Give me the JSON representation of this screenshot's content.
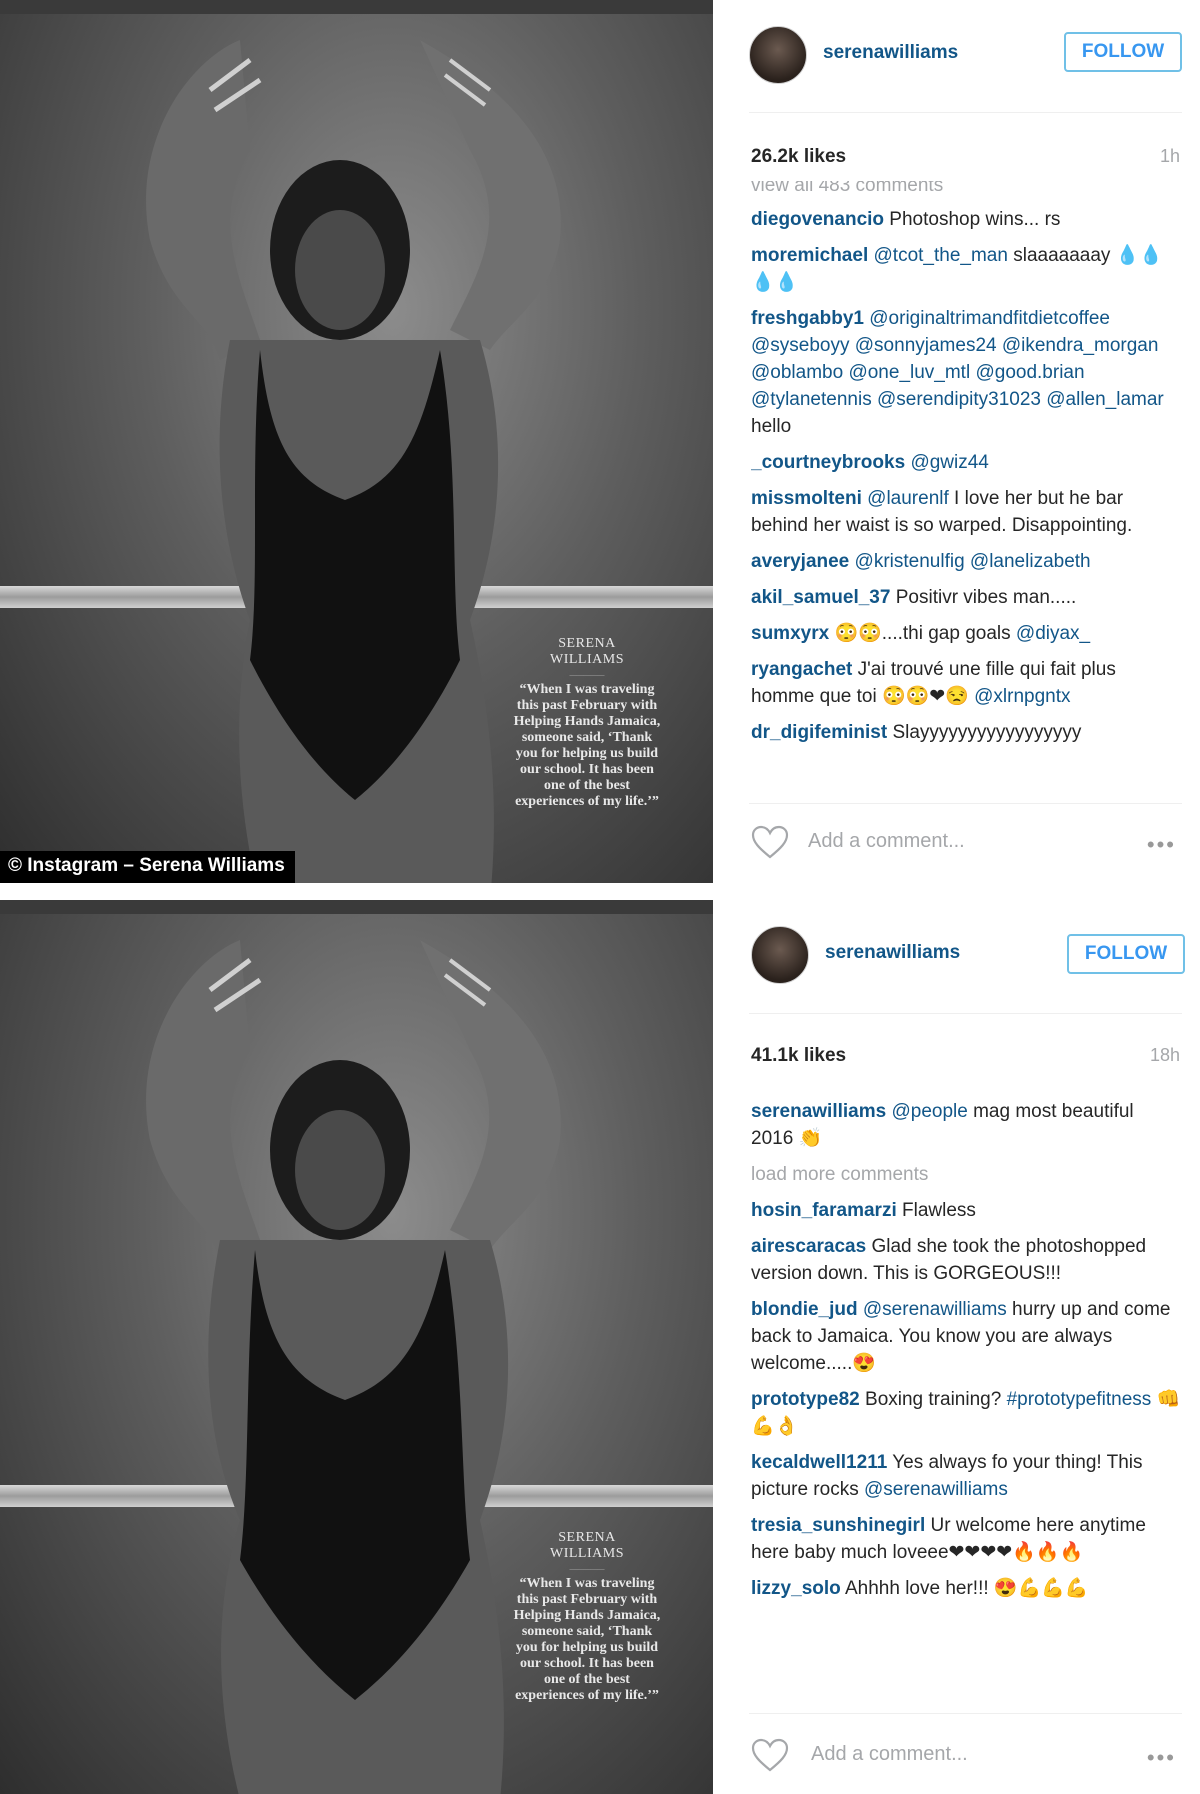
{
  "posts": [
    {
      "credit": "© Instagram – Serena Williams",
      "magazine_caption": {
        "name": "SERENA\nWILLIAMS",
        "quote": "“When I was traveling this past February with Helping Hands Jamaica, someone said, ‘Thank you for helping us build our school. It has been one of the best experiences of my life.’”"
      },
      "username": "serenawilliams",
      "follow_label": "FOLLOW",
      "likes": "26.2k likes",
      "time": "1h",
      "view_all": "view all 483 comments",
      "comments": [
        {
          "user": "diegovenancio",
          "parts": [
            {
              "t": " Photoshop wins... rs"
            }
          ]
        },
        {
          "user": "moremichael",
          "parts": [
            {
              "t": " "
            },
            {
              "m": "@tcot_the_man"
            },
            {
              "t": " slaaaaaaay 💧💧💧💧"
            }
          ]
        },
        {
          "user": "freshgabby1",
          "parts": [
            {
              "t": " "
            },
            {
              "m": "@originaltrimandfitdietcoffee @syseboyy @sonnyjames24 @ikendra_morgan @oblambo @one_luv_mtl @good.brian @tylanetennis @serendipity31023 @allen_lamar"
            },
            {
              "t": " hello"
            }
          ]
        },
        {
          "user": "_courtneybrooks",
          "parts": [
            {
              "t": " "
            },
            {
              "m": "@gwiz44"
            }
          ]
        },
        {
          "user": "missmolteni",
          "parts": [
            {
              "t": " "
            },
            {
              "m": "@laurenlf"
            },
            {
              "t": " I love her but he bar behind her waist is so warped. Disappointing."
            }
          ]
        },
        {
          "user": "averyjanee",
          "parts": [
            {
              "t": " "
            },
            {
              "m": "@kristenulfig @lanelizabeth"
            }
          ]
        },
        {
          "user": "akil_samuel_37",
          "parts": [
            {
              "t": " Positivr vibes man....."
            }
          ]
        },
        {
          "user": "sumxyrx",
          "parts": [
            {
              "t": " 😳😳....thi gap goals "
            },
            {
              "m": "@diyax_"
            }
          ]
        },
        {
          "user": "ryangachet",
          "parts": [
            {
              "t": " J'ai trouvé une fille qui fait plus homme que toi 😳😳❤😒 "
            },
            {
              "m": "@xlrnpgntx"
            }
          ]
        },
        {
          "user": "dr_digifeminist",
          "parts": [
            {
              "t": " Slayyyyyyyyyyyyyyyyy"
            }
          ]
        }
      ],
      "add_comment_placeholder": "Add a comment...",
      "more_label": "•••"
    },
    {
      "magazine_caption": {
        "name": "SERENA\nWILLIAMS",
        "quote": "“When I was traveling this past February with Helping Hands Jamaica, someone said, ‘Thank you for helping us build our school. It has been one of the best experiences of my life.’”"
      },
      "username": "serenawilliams",
      "follow_label": "FOLLOW",
      "likes": "41.1k likes",
      "time": "18h",
      "load_more": "load more comments",
      "comments": [
        {
          "user": "serenawilliams",
          "parts": [
            {
              "t": " "
            },
            {
              "m": "@people"
            },
            {
              "t": " mag most beautiful 2016 👏"
            }
          ]
        },
        {
          "user": "hosin_faramarzi",
          "parts": [
            {
              "t": " Flawless"
            }
          ]
        },
        {
          "user": "airescaracas",
          "parts": [
            {
              "t": " Glad she took the photoshopped version down. This is GORGEOUS!!!"
            }
          ]
        },
        {
          "user": "blondie_jud",
          "parts": [
            {
              "t": " "
            },
            {
              "m": "@serenawilliams"
            },
            {
              "t": " hurry up and come back to Jamaica. You know you are always welcome.....😍"
            }
          ]
        },
        {
          "user": "prototype82",
          "parts": [
            {
              "t": " Boxing training? "
            },
            {
              "m": "#prototypefitness"
            },
            {
              "t": " 👊💪👌"
            }
          ]
        },
        {
          "user": "kecaldwell1211",
          "parts": [
            {
              "t": " Yes always fo your thing! This picture rocks "
            },
            {
              "m": "@serenawilliams"
            }
          ]
        },
        {
          "user": "tresia_sunshinegirl",
          "parts": [
            {
              "t": " Ur welcome here anytime here baby much loveee❤❤❤❤🔥🔥🔥"
            }
          ]
        },
        {
          "user": "lizzy_solo",
          "parts": [
            {
              "t": " Ahhhh love her!!! 😍💪💪💪"
            }
          ]
        }
      ],
      "add_comment_placeholder": "Add a comment...",
      "more_label": "•••"
    }
  ]
}
